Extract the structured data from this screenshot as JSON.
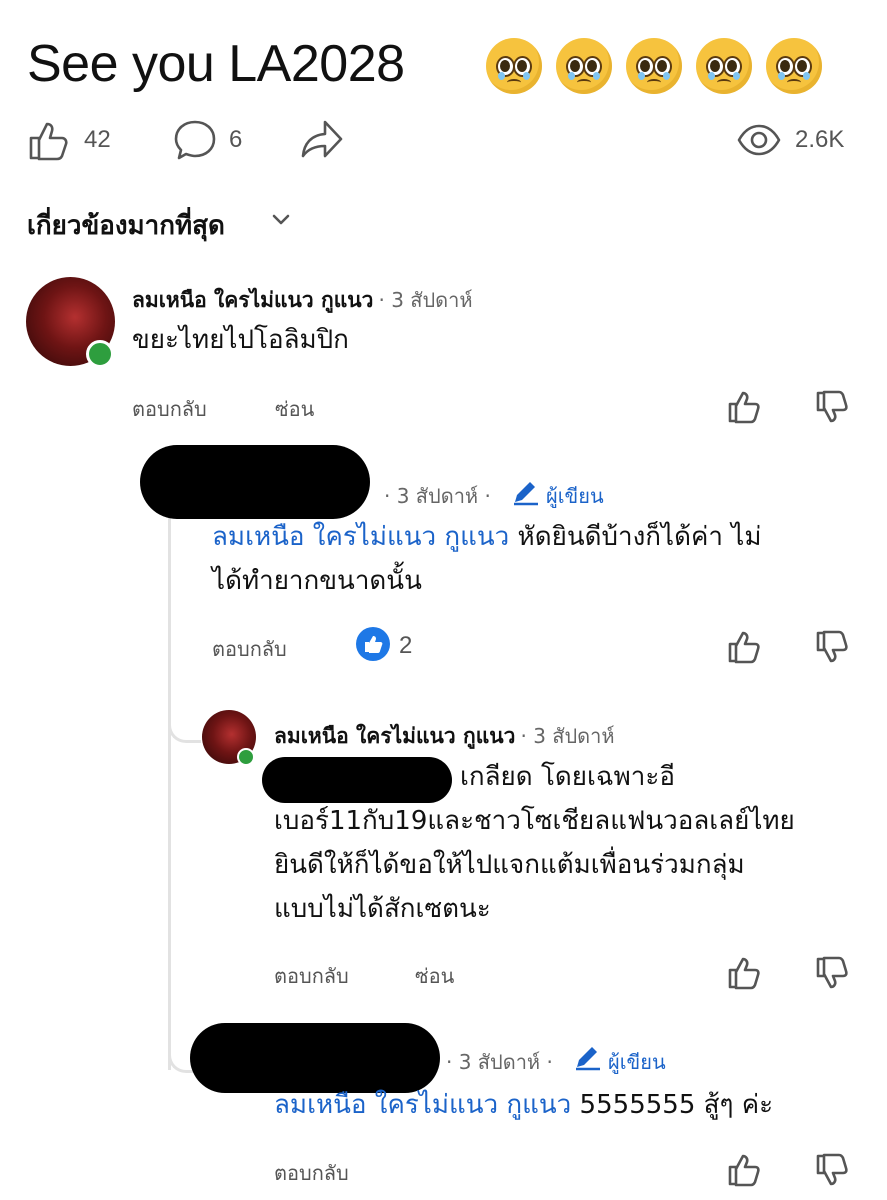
{
  "post": {
    "title": "See you LA2028",
    "likes": "42",
    "comments": "6",
    "views": "2.6K"
  },
  "sort": {
    "label": "เกี่ยวข้องมากที่สุด"
  },
  "comments": [
    {
      "author": "ลมเหนือ ใครไม่แนว กูแนว",
      "time": "· 3 สัปดาห์",
      "text": "ขยะไทยไปโอลิมปิก",
      "reply_label": "ตอบกลับ",
      "hide_label": "ซ่อน"
    },
    {
      "time": "· 3 สัปดาห์ ·",
      "author_badge": "ผู้เขียน",
      "mention": "ลมเหนือ ใครไม่แนว กูแนว",
      "text_line1": " หัดยินดีบ้างก็ได้ค่า ไม่",
      "text_line2": "ได้ทำยากขนาดนั้น",
      "reply_label": "ตอบกลับ",
      "like_count": "2"
    },
    {
      "author": "ลมเหนือ ใครไม่แนว กูแนว",
      "time": "· 3 สัปดาห์",
      "text_line1": "เกลียด  โดยเฉพาะอี",
      "text_line2": "เบอร์11กับ19และชาวโซเชียลแฟนวอลเลย์ไทย",
      "text_line3": "ยินดีให้ก็ได้ขอให้ไปแจกแต้มเพื่อนร่วมกลุ่ม",
      "text_line4": "แบบไม่ได้สักเซตนะ",
      "reply_label": "ตอบกลับ",
      "hide_label": "ซ่อน"
    },
    {
      "time": "· 3 สัปดาห์ ·",
      "author_badge": "ผู้เขียน",
      "mention": "ลมเหนือ ใครไม่แนว กูแนว",
      "text": " 5555555 สู้ๆ ค่ะ",
      "reply_label": "ตอบกลับ"
    }
  ],
  "icons": {
    "like": "thumbs-up-icon",
    "comment": "speech-bubble-icon",
    "share": "share-arrow-icon",
    "views": "eye-icon",
    "dislike": "thumbs-down-icon",
    "edit": "pencil-icon",
    "chevron": "chevron-down-icon",
    "emoji": "pleading-face-emoji"
  },
  "colors": {
    "mention": "#1b63c9",
    "like_badge": "#1e78e6",
    "online": "#2e9e3e"
  }
}
